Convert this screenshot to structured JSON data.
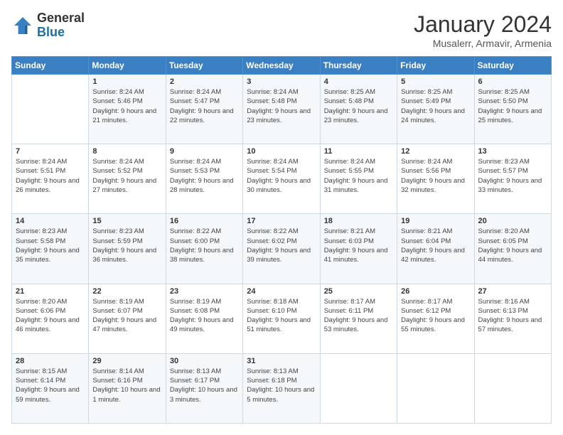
{
  "logo": {
    "general": "General",
    "blue": "Blue"
  },
  "header": {
    "month_year": "January 2024",
    "location": "Musalerr, Armavir, Armenia"
  },
  "weekdays": [
    "Sunday",
    "Monday",
    "Tuesday",
    "Wednesday",
    "Thursday",
    "Friday",
    "Saturday"
  ],
  "weeks": [
    [
      {
        "day": "",
        "sunrise": "",
        "sunset": "",
        "daylight": ""
      },
      {
        "day": "1",
        "sunrise": "Sunrise: 8:24 AM",
        "sunset": "Sunset: 5:46 PM",
        "daylight": "Daylight: 9 hours and 21 minutes."
      },
      {
        "day": "2",
        "sunrise": "Sunrise: 8:24 AM",
        "sunset": "Sunset: 5:47 PM",
        "daylight": "Daylight: 9 hours and 22 minutes."
      },
      {
        "day": "3",
        "sunrise": "Sunrise: 8:24 AM",
        "sunset": "Sunset: 5:48 PM",
        "daylight": "Daylight: 9 hours and 23 minutes."
      },
      {
        "day": "4",
        "sunrise": "Sunrise: 8:25 AM",
        "sunset": "Sunset: 5:48 PM",
        "daylight": "Daylight: 9 hours and 23 minutes."
      },
      {
        "day": "5",
        "sunrise": "Sunrise: 8:25 AM",
        "sunset": "Sunset: 5:49 PM",
        "daylight": "Daylight: 9 hours and 24 minutes."
      },
      {
        "day": "6",
        "sunrise": "Sunrise: 8:25 AM",
        "sunset": "Sunset: 5:50 PM",
        "daylight": "Daylight: 9 hours and 25 minutes."
      }
    ],
    [
      {
        "day": "7",
        "sunrise": "Sunrise: 8:24 AM",
        "sunset": "Sunset: 5:51 PM",
        "daylight": "Daylight: 9 hours and 26 minutes."
      },
      {
        "day": "8",
        "sunrise": "Sunrise: 8:24 AM",
        "sunset": "Sunset: 5:52 PM",
        "daylight": "Daylight: 9 hours and 27 minutes."
      },
      {
        "day": "9",
        "sunrise": "Sunrise: 8:24 AM",
        "sunset": "Sunset: 5:53 PM",
        "daylight": "Daylight: 9 hours and 28 minutes."
      },
      {
        "day": "10",
        "sunrise": "Sunrise: 8:24 AM",
        "sunset": "Sunset: 5:54 PM",
        "daylight": "Daylight: 9 hours and 30 minutes."
      },
      {
        "day": "11",
        "sunrise": "Sunrise: 8:24 AM",
        "sunset": "Sunset: 5:55 PM",
        "daylight": "Daylight: 9 hours and 31 minutes."
      },
      {
        "day": "12",
        "sunrise": "Sunrise: 8:24 AM",
        "sunset": "Sunset: 5:56 PM",
        "daylight": "Daylight: 9 hours and 32 minutes."
      },
      {
        "day": "13",
        "sunrise": "Sunrise: 8:23 AM",
        "sunset": "Sunset: 5:57 PM",
        "daylight": "Daylight: 9 hours and 33 minutes."
      }
    ],
    [
      {
        "day": "14",
        "sunrise": "Sunrise: 8:23 AM",
        "sunset": "Sunset: 5:58 PM",
        "daylight": "Daylight: 9 hours and 35 minutes."
      },
      {
        "day": "15",
        "sunrise": "Sunrise: 8:23 AM",
        "sunset": "Sunset: 5:59 PM",
        "daylight": "Daylight: 9 hours and 36 minutes."
      },
      {
        "day": "16",
        "sunrise": "Sunrise: 8:22 AM",
        "sunset": "Sunset: 6:00 PM",
        "daylight": "Daylight: 9 hours and 38 minutes."
      },
      {
        "day": "17",
        "sunrise": "Sunrise: 8:22 AM",
        "sunset": "Sunset: 6:02 PM",
        "daylight": "Daylight: 9 hours and 39 minutes."
      },
      {
        "day": "18",
        "sunrise": "Sunrise: 8:21 AM",
        "sunset": "Sunset: 6:03 PM",
        "daylight": "Daylight: 9 hours and 41 minutes."
      },
      {
        "day": "19",
        "sunrise": "Sunrise: 8:21 AM",
        "sunset": "Sunset: 6:04 PM",
        "daylight": "Daylight: 9 hours and 42 minutes."
      },
      {
        "day": "20",
        "sunrise": "Sunrise: 8:20 AM",
        "sunset": "Sunset: 6:05 PM",
        "daylight": "Daylight: 9 hours and 44 minutes."
      }
    ],
    [
      {
        "day": "21",
        "sunrise": "Sunrise: 8:20 AM",
        "sunset": "Sunset: 6:06 PM",
        "daylight": "Daylight: 9 hours and 46 minutes."
      },
      {
        "day": "22",
        "sunrise": "Sunrise: 8:19 AM",
        "sunset": "Sunset: 6:07 PM",
        "daylight": "Daylight: 9 hours and 47 minutes."
      },
      {
        "day": "23",
        "sunrise": "Sunrise: 8:19 AM",
        "sunset": "Sunset: 6:08 PM",
        "daylight": "Daylight: 9 hours and 49 minutes."
      },
      {
        "day": "24",
        "sunrise": "Sunrise: 8:18 AM",
        "sunset": "Sunset: 6:10 PM",
        "daylight": "Daylight: 9 hours and 51 minutes."
      },
      {
        "day": "25",
        "sunrise": "Sunrise: 8:17 AM",
        "sunset": "Sunset: 6:11 PM",
        "daylight": "Daylight: 9 hours and 53 minutes."
      },
      {
        "day": "26",
        "sunrise": "Sunrise: 8:17 AM",
        "sunset": "Sunset: 6:12 PM",
        "daylight": "Daylight: 9 hours and 55 minutes."
      },
      {
        "day": "27",
        "sunrise": "Sunrise: 8:16 AM",
        "sunset": "Sunset: 6:13 PM",
        "daylight": "Daylight: 9 hours and 57 minutes."
      }
    ],
    [
      {
        "day": "28",
        "sunrise": "Sunrise: 8:15 AM",
        "sunset": "Sunset: 6:14 PM",
        "daylight": "Daylight: 9 hours and 59 minutes."
      },
      {
        "day": "29",
        "sunrise": "Sunrise: 8:14 AM",
        "sunset": "Sunset: 6:16 PM",
        "daylight": "Daylight: 10 hours and 1 minute."
      },
      {
        "day": "30",
        "sunrise": "Sunrise: 8:13 AM",
        "sunset": "Sunset: 6:17 PM",
        "daylight": "Daylight: 10 hours and 3 minutes."
      },
      {
        "day": "31",
        "sunrise": "Sunrise: 8:13 AM",
        "sunset": "Sunset: 6:18 PM",
        "daylight": "Daylight: 10 hours and 5 minutes."
      },
      {
        "day": "",
        "sunrise": "",
        "sunset": "",
        "daylight": ""
      },
      {
        "day": "",
        "sunrise": "",
        "sunset": "",
        "daylight": ""
      },
      {
        "day": "",
        "sunrise": "",
        "sunset": "",
        "daylight": ""
      }
    ]
  ]
}
